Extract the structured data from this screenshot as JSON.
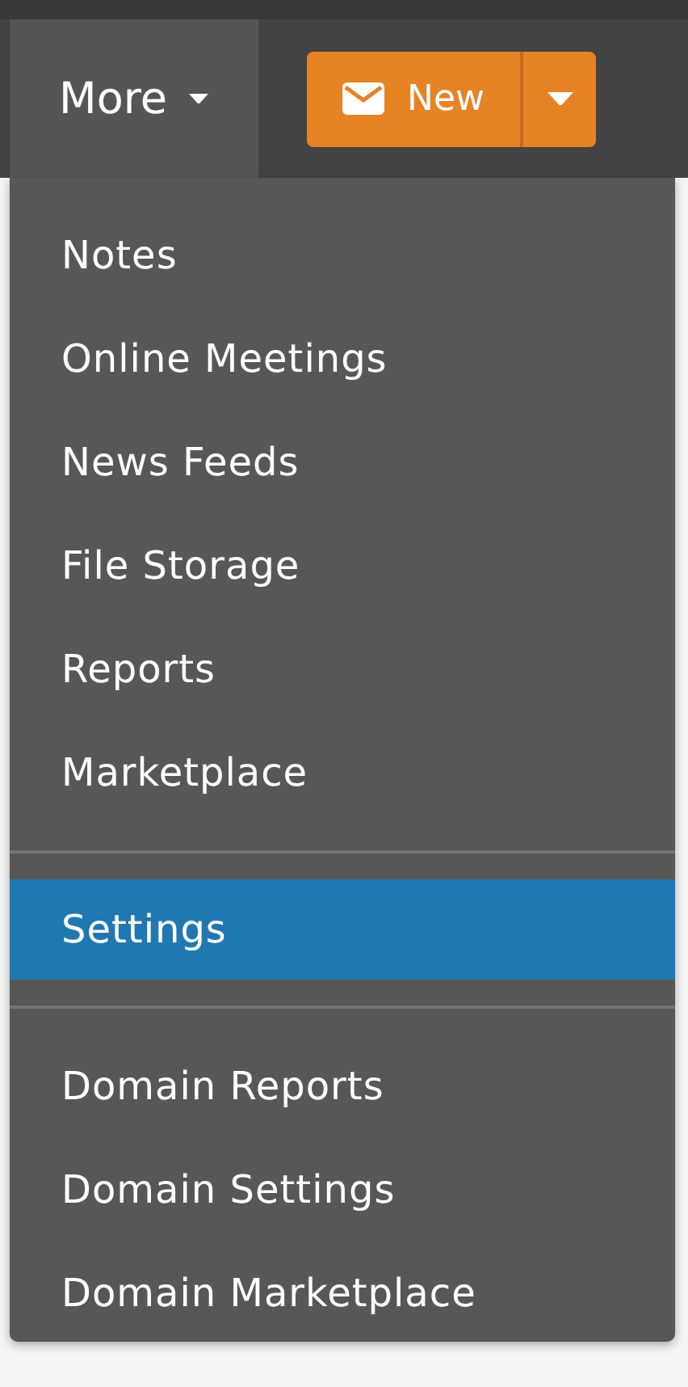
{
  "toolbar": {
    "more_tab": {
      "label": "More",
      "selected": true
    },
    "new_button": {
      "label": "New"
    }
  },
  "menu": {
    "groups": [
      {
        "items": [
          {
            "label": "Notes",
            "selected": false
          },
          {
            "label": "Online Meetings",
            "selected": false
          },
          {
            "label": "News Feeds",
            "selected": false
          },
          {
            "label": "File Storage",
            "selected": false
          },
          {
            "label": "Reports",
            "selected": false
          },
          {
            "label": "Marketplace",
            "selected": false
          }
        ]
      },
      {
        "items": [
          {
            "label": "Settings",
            "selected": true
          }
        ]
      },
      {
        "items": [
          {
            "label": "Domain Reports",
            "selected": false
          },
          {
            "label": "Domain Settings",
            "selected": false
          },
          {
            "label": "Domain Marketplace",
            "selected": false
          }
        ]
      }
    ]
  }
}
